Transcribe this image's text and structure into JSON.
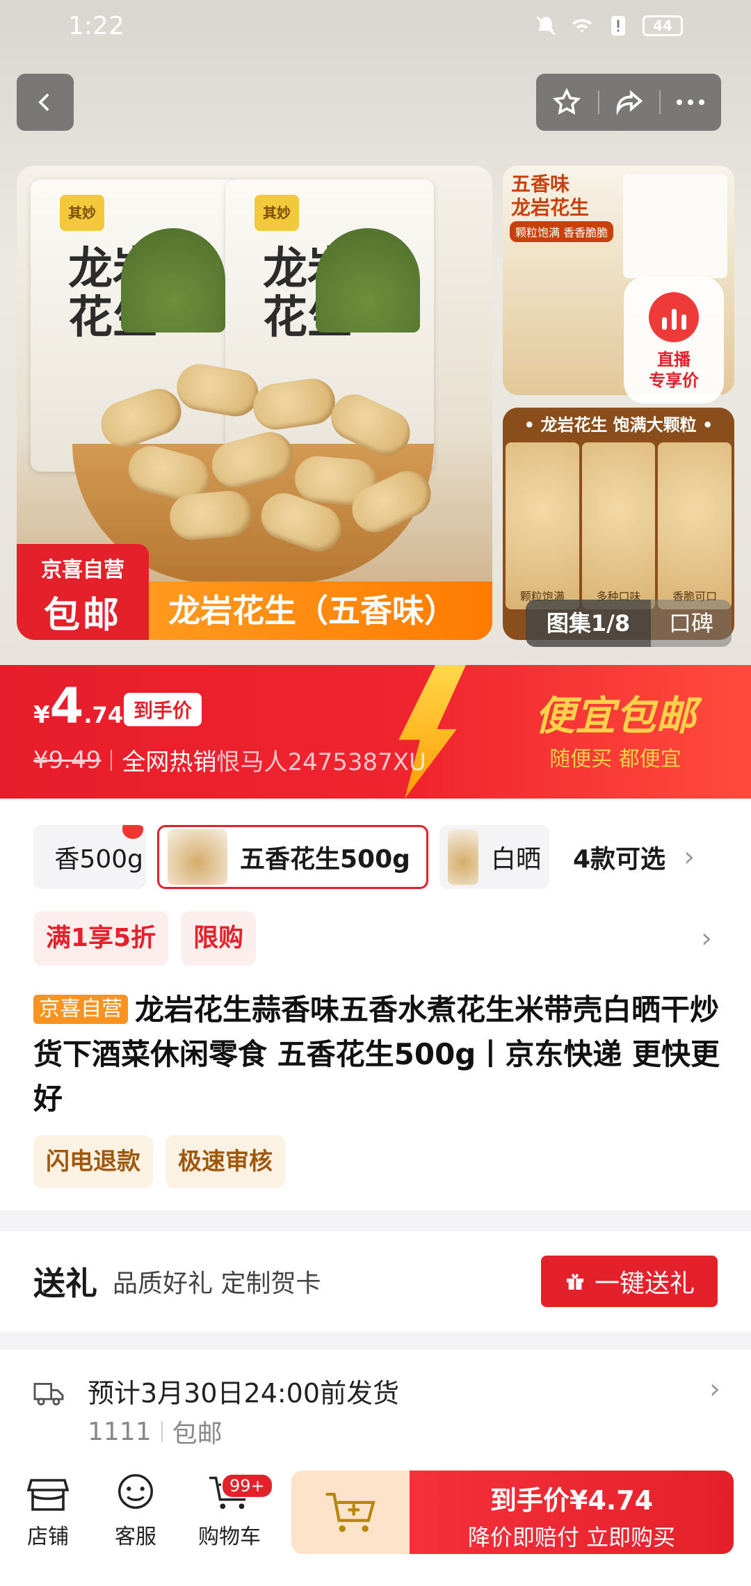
{
  "status_bar": {
    "time": "1:22",
    "battery": "44"
  },
  "gallery": {
    "main_badge_line1": "京喜自营",
    "main_badge_line2": "包邮",
    "main_banner": "龙岩花生（五香味）",
    "bag_brand": "其妙",
    "bag_name": "龙岩花生",
    "side_top_title": "五香味\n龙岩花生",
    "side_top_sub": "颗粒饱满 香香脆脆",
    "live_label": "直播\n专享价",
    "side_bottom_header": "• 龙岩花生 饱满大颗粒 •",
    "side_bottom_cells": [
      "颗粒饱满",
      "多种口味",
      "香脆可口"
    ],
    "count": "图集1/8",
    "reviews": "口碑"
  },
  "price_banner": {
    "currency": "¥",
    "price_int": "4",
    "price_dec": ".74",
    "tag": "到手价",
    "old_price": "¥9.49",
    "hot_text": "全网热销",
    "watermark": "恨马人2475387XU",
    "promo_title": "便宜包邮",
    "promo_sub": "随便买 都便宜"
  },
  "sku": {
    "items": [
      "香500g",
      "五香花生500g",
      "白晒"
    ],
    "selected_index": 1,
    "count_label": "4款可选"
  },
  "promos": [
    "满1享5折",
    "限购"
  ],
  "product": {
    "self_tag": "京喜自营",
    "title": "龙岩花生蒜香味五香水煮花生米带壳白晒干炒货下酒菜休闲零食 五香花生500g丨京东快递 更快更好",
    "services": [
      "闪电退款",
      "极速审核"
    ]
  },
  "gift": {
    "title": "送礼",
    "subtitle": "品质好礼 定制贺卡",
    "button": "一键送礼"
  },
  "delivery": {
    "text": "预计3月30日24:00前发货",
    "code": "1111",
    "shipping": "包邮"
  },
  "bottom_bar": {
    "shop": "店铺",
    "service": "客服",
    "cart": "购物车",
    "cart_badge": "99+",
    "buy_line1": "到手价¥4.74",
    "buy_line2": "降价即赔付 立即购买"
  },
  "colors": {
    "accent": "#e4202a",
    "orange": "#ff7b00",
    "gold": "#ffd04a"
  }
}
